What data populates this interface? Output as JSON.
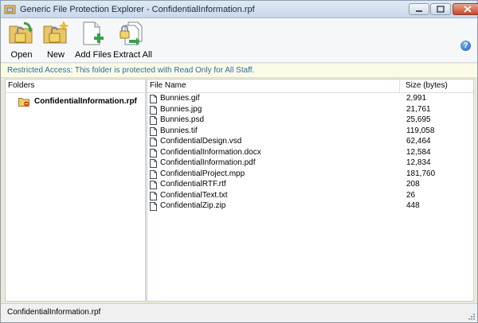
{
  "window": {
    "title": "Generic File Protection Explorer - ConfidentialInformation.rpf"
  },
  "toolbar": {
    "buttons": [
      {
        "label": "Open",
        "icon": "open-lock-folder-icon"
      },
      {
        "label": "New",
        "icon": "new-lock-folder-icon"
      },
      {
        "label": "Add Files",
        "icon": "add-files-icon"
      },
      {
        "label": "Extract All",
        "icon": "extract-all-icon"
      }
    ],
    "help_icon": "help-icon"
  },
  "restricted_message": "Restricted Access:  This folder is protected with Read Only for All Staff.",
  "folders": {
    "header": "Folders",
    "items": [
      {
        "label": "ConfidentialInformation.rpf",
        "icon": "locked-folder-icon"
      }
    ]
  },
  "files": {
    "columns": {
      "name": "File Name",
      "size": "Size (bytes)"
    },
    "rows": [
      {
        "name": "Bunnies.gif",
        "size": "2,991"
      },
      {
        "name": "Bunnies.jpg",
        "size": "21,761"
      },
      {
        "name": "Bunnies.psd",
        "size": "25,695"
      },
      {
        "name": "Bunnies.tif",
        "size": "119,058"
      },
      {
        "name": "ConfidentialDesign.vsd",
        "size": "62,464"
      },
      {
        "name": "ConfidentialInformation.docx",
        "size": "12,584"
      },
      {
        "name": "ConfidentialInformation.pdf",
        "size": "12,834"
      },
      {
        "name": "ConfidentialProject.mpp",
        "size": "181,760"
      },
      {
        "name": "ConfidentialRTF.rtf",
        "size": "208"
      },
      {
        "name": "ConfidentialText.txt",
        "size": "26"
      },
      {
        "name": "ConfidentialZip.zip",
        "size": "448"
      }
    ]
  },
  "status": {
    "text": "ConfidentialInformation.rpf"
  }
}
